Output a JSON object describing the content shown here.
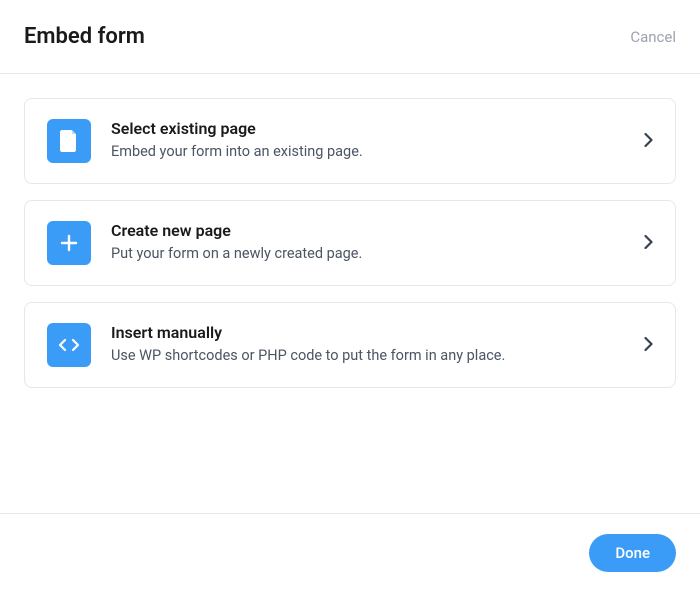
{
  "header": {
    "title": "Embed form",
    "cancel_label": "Cancel"
  },
  "options": [
    {
      "icon": "page-icon",
      "title": "Select existing page",
      "description": "Embed your form into an existing page."
    },
    {
      "icon": "plus-icon",
      "title": "Create new page",
      "description": "Put your form on a newly created page."
    },
    {
      "icon": "code-icon",
      "title": "Insert manually",
      "description": "Use WP shortcodes or PHP code to put the form in any place."
    }
  ],
  "footer": {
    "done_label": "Done"
  },
  "colors": {
    "accent": "#3b9cf7"
  }
}
